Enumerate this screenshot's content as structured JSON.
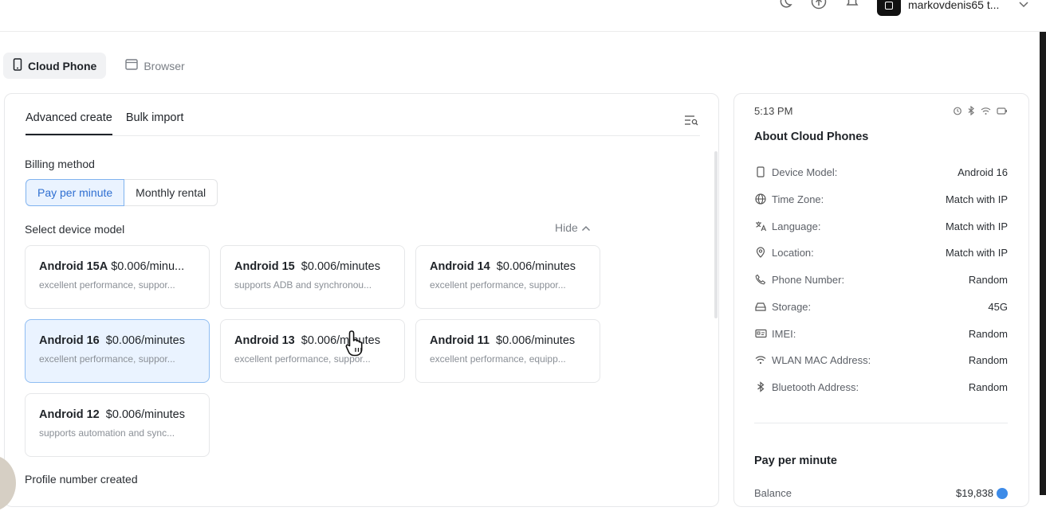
{
  "topbar": {
    "icons": [
      "moon-icon",
      "upload-icon",
      "bell-icon"
    ],
    "username": "markovdenis65 t..."
  },
  "mode_tabs": [
    {
      "label": "Cloud Phone",
      "icon": "phone-icon",
      "active": true
    },
    {
      "label": "Browser",
      "icon": "browser-icon",
      "active": false
    }
  ],
  "create": {
    "tabs": [
      {
        "label": "Advanced create",
        "active": true
      },
      {
        "label": "Bulk import",
        "active": false
      }
    ],
    "billing_label": "Billing method",
    "billing_options": [
      {
        "label": "Pay per minute",
        "active": true
      },
      {
        "label": "Monthly rental",
        "active": false
      }
    ],
    "device_label": "Select device model",
    "hide_label": "Hide",
    "devices": [
      {
        "name": "Android 15A",
        "price": "$0.006/minu...",
        "desc": "excellent performance, suppor...",
        "selected": false
      },
      {
        "name": "Android 15",
        "price": "$0.006/minutes",
        "desc": "supports ADB and synchronou...",
        "selected": false
      },
      {
        "name": "Android 14",
        "price": "$0.006/minutes",
        "desc": "excellent performance, suppor...",
        "selected": false
      },
      {
        "name": "Android 16",
        "price": "$0.006/minutes",
        "desc": "excellent performance, suppor...",
        "selected": true
      },
      {
        "name": "Android 13",
        "price": "$0.006/minutes",
        "desc": "excellent performance, suppor...",
        "selected": false
      },
      {
        "name": "Android 11",
        "price": "$0.006/minutes",
        "desc": "excellent performance, equipp...",
        "selected": false
      },
      {
        "name": "Android 12",
        "price": "$0.006/minutes",
        "desc": "supports automation and sync...",
        "selected": false
      }
    ],
    "profile_label": "Profile number created"
  },
  "about": {
    "time": "5:13 PM",
    "title": "About Cloud Phones",
    "specs": [
      {
        "icon": "phone-icon",
        "label": "Device Model:",
        "value": "Android 16"
      },
      {
        "icon": "globe-icon",
        "label": "Time Zone:",
        "value": "Match with IP"
      },
      {
        "icon": "translate-icon",
        "label": "Language:",
        "value": "Match with IP"
      },
      {
        "icon": "location-pin-icon",
        "label": "Location:",
        "value": "Match with IP"
      },
      {
        "icon": "call-icon",
        "label": "Phone Number:",
        "value": "Random"
      },
      {
        "icon": "storage-icon",
        "label": "Storage:",
        "value": "45G"
      },
      {
        "icon": "id-card-icon",
        "label": "IMEI:",
        "value": "Random"
      },
      {
        "icon": "wifi-icon",
        "label": "WLAN MAC Address:",
        "value": "Random"
      },
      {
        "icon": "bluetooth-icon",
        "label": "Bluetooth Address:",
        "value": "Random"
      }
    ],
    "pay_title": "Pay per minute",
    "balance_label": "Balance",
    "balance_value": "$19,838"
  },
  "colors": {
    "accent": "#2f6fd1",
    "selected_bg": "#eaf3ff",
    "selected_border": "#8fbdf2"
  }
}
